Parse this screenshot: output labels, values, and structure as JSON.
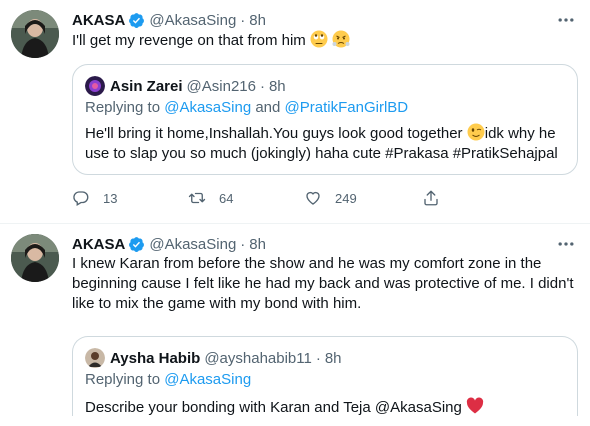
{
  "tweets": [
    {
      "author": {
        "name": "AKASA",
        "handle": "@AkasaSing",
        "time": "8h",
        "verified": true
      },
      "text": "I'll get my revenge on that from him",
      "emojis": [
        "face-with-rolling-eyes",
        "face-with-steam"
      ],
      "quote": {
        "author": {
          "name": "Asin Zarei",
          "handle": "@Asin216",
          "time": "8h"
        },
        "replying_prefix": "Replying to ",
        "replying_mentions": [
          "@AkasaSing",
          "@PratikFanGirlBD"
        ],
        "replying_joiner": " and ",
        "text_part1": "He'll bring it home,Inshallah.You guys look good together ",
        "text_part2": "idk why he use to slap you so much (jokingly) haha cute #Prakasa  #PratikSehajpal",
        "emoji": "winking-face"
      },
      "stats": {
        "replies": "13",
        "retweets": "64",
        "likes": "249"
      }
    },
    {
      "author": {
        "name": "AKASA",
        "handle": "@AkasaSing",
        "time": "8h",
        "verified": true
      },
      "text": "I knew Karan from before the show and he was my comfort zone in the beginning cause I felt like he had my back and was protective of me. I didn't like to mix the game with my bond with him.",
      "quote": {
        "author": {
          "name": "Aysha Habib",
          "handle": "@ayshahabib11",
          "time": "8h"
        },
        "replying_prefix": "Replying to ",
        "replying_mentions": [
          "@AkasaSing"
        ],
        "text": "Describe your bonding with Karan and Teja @AkasaSing",
        "emoji": "red-heart"
      }
    }
  ],
  "colors": {
    "accent": "#1d9bf0",
    "secondary_text": "#536471",
    "border": "#cfd9de"
  }
}
